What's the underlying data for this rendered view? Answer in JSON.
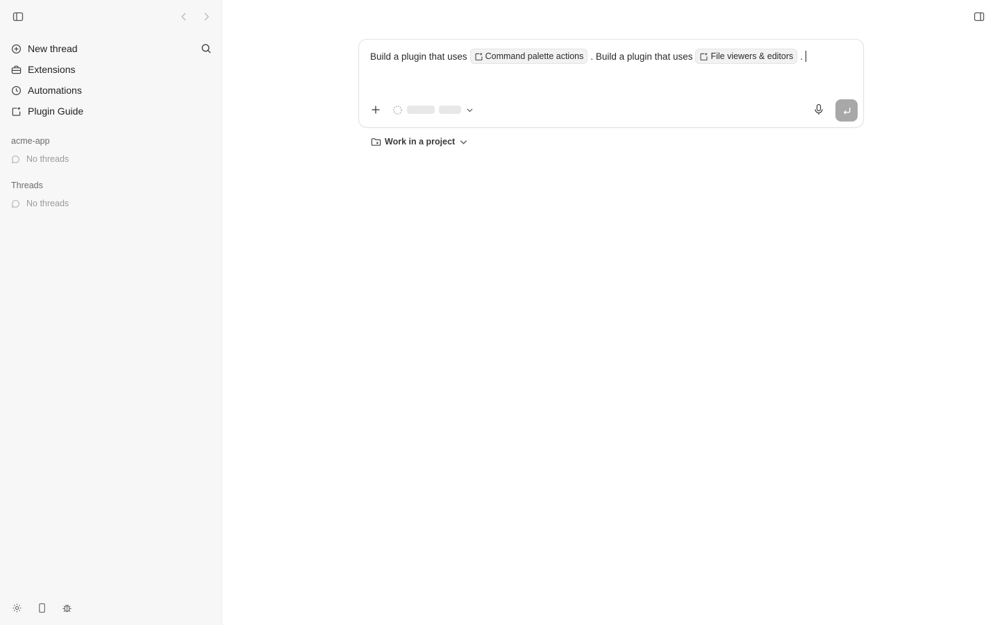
{
  "sidebar": {
    "nav": [
      {
        "label": "New thread",
        "icon": "plus-circle-icon"
      },
      {
        "label": "Extensions",
        "icon": "toolbox-icon"
      },
      {
        "label": "Automations",
        "icon": "clock-icon"
      },
      {
        "label": "Plugin Guide",
        "icon": "plugin-icon"
      }
    ],
    "sections": [
      {
        "label": "acme-app",
        "empty_text": "No threads"
      },
      {
        "label": "Threads",
        "empty_text": "No threads"
      }
    ]
  },
  "composer": {
    "segments": [
      {
        "text": "Build a plugin that uses"
      },
      {
        "chip": "Command palette actions"
      },
      {
        "text": ". Build a plugin that uses"
      },
      {
        "chip": "File viewers & editors"
      },
      {
        "text": "."
      }
    ]
  },
  "project": {
    "label": "Work in a project"
  },
  "colors": {
    "sidebar_bg": "#f7f7f7",
    "send_button": "#a8a8a8",
    "chip_bg": "#f2f2f2"
  }
}
